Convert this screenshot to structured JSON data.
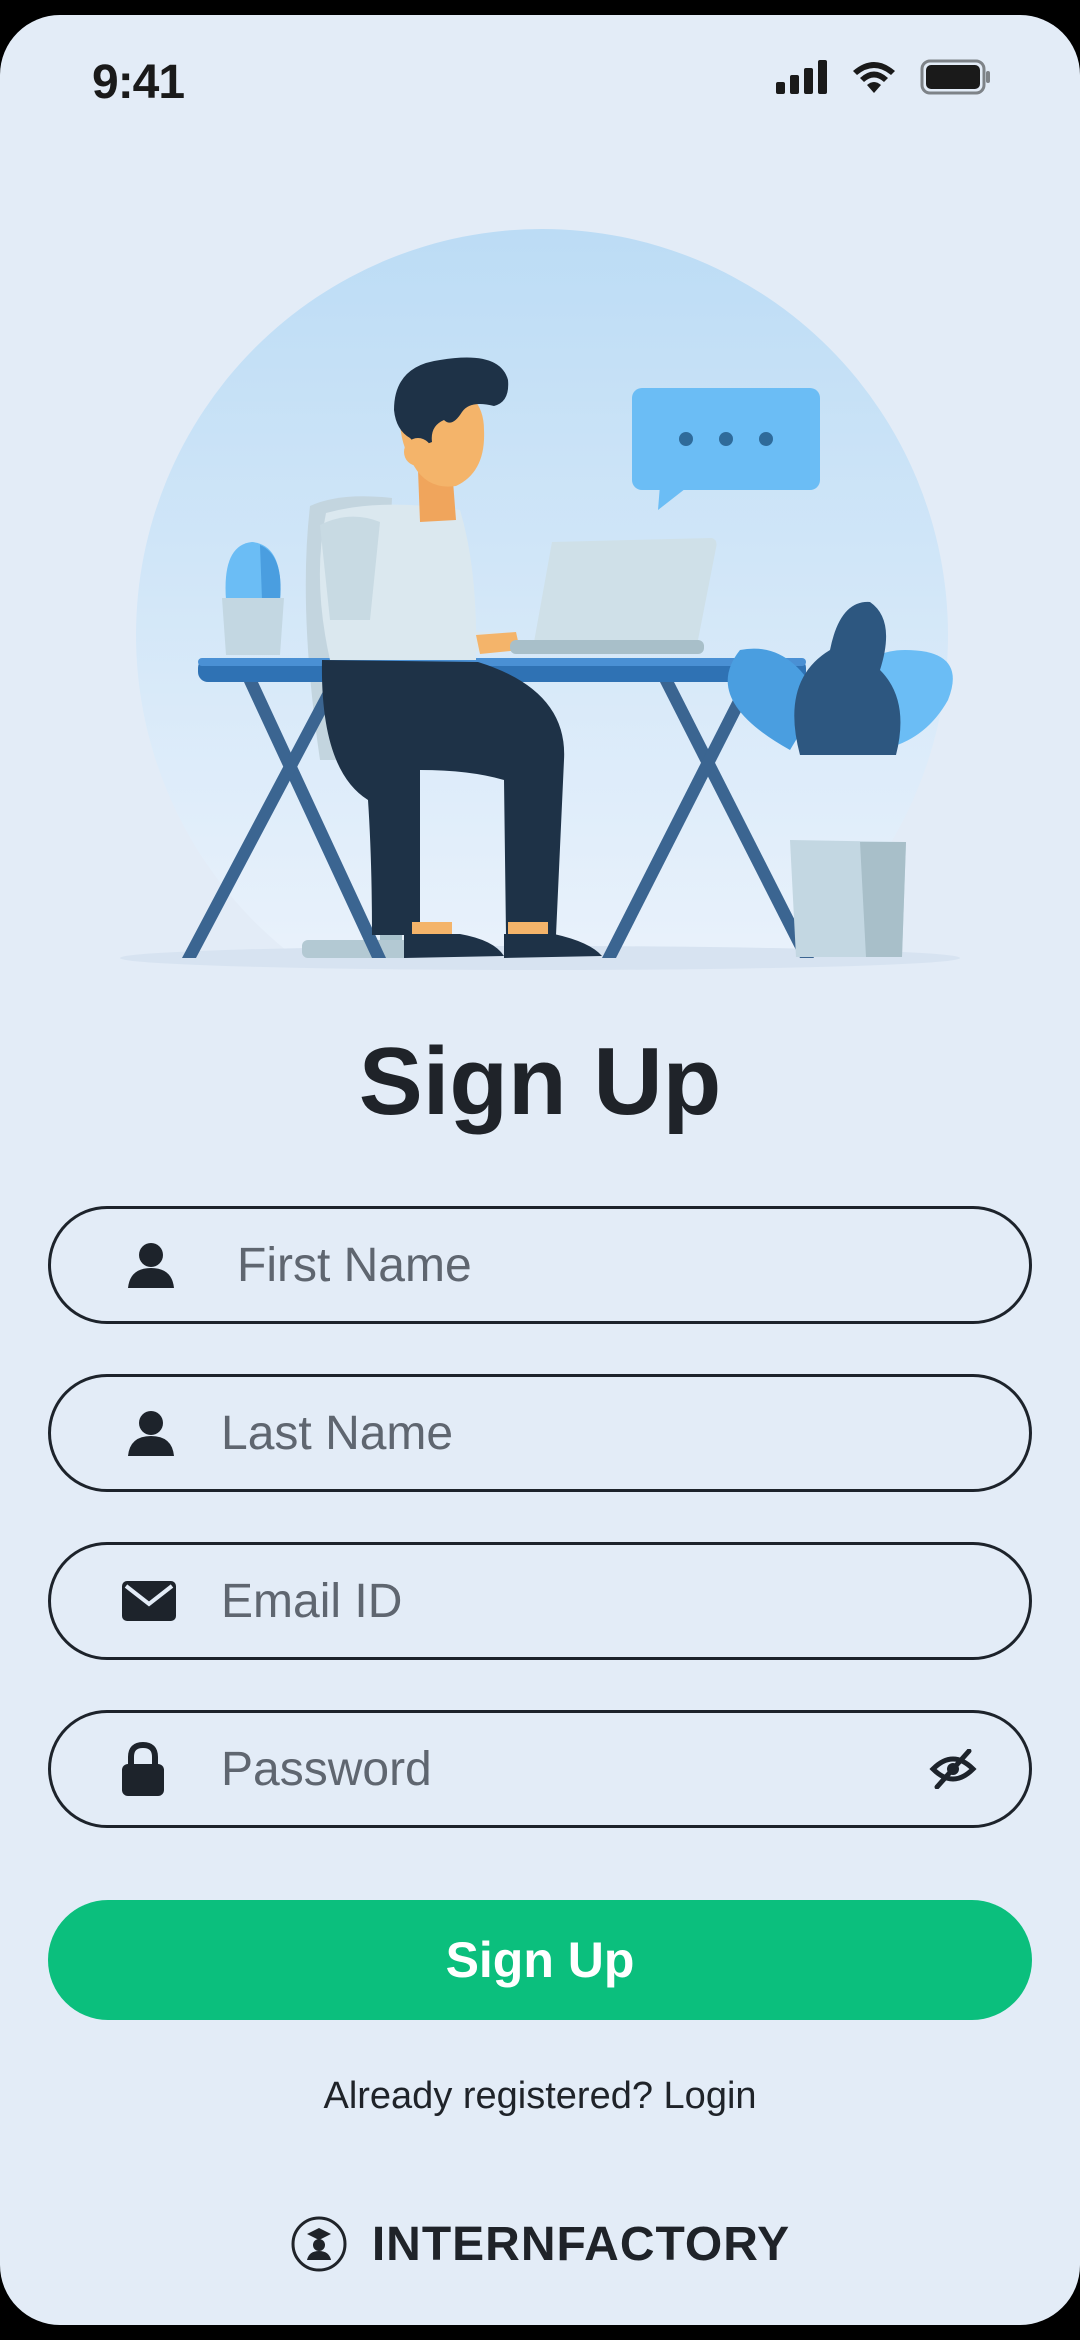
{
  "status_bar": {
    "time": "9:41"
  },
  "page": {
    "title": "Sign Up"
  },
  "form": {
    "first_name_placeholder": "First Name",
    "last_name_placeholder": "Last Name",
    "email_placeholder": "Email ID",
    "password_placeholder": "Password",
    "submit_label": "Sign Up"
  },
  "footer": {
    "already_registered": "Already registered? ",
    "login_link": "Login",
    "brand": "INTERNFACTORY"
  },
  "icons": {
    "first_name": "person-icon",
    "last_name": "person-icon",
    "email": "envelope-icon",
    "password": "lock-icon",
    "password_toggle": "eye-off-icon",
    "brand": "internfactory-logo-icon"
  },
  "colors": {
    "background": "#e3ecf7",
    "primary_button": "#0bbf7d",
    "text": "#1f2329"
  }
}
